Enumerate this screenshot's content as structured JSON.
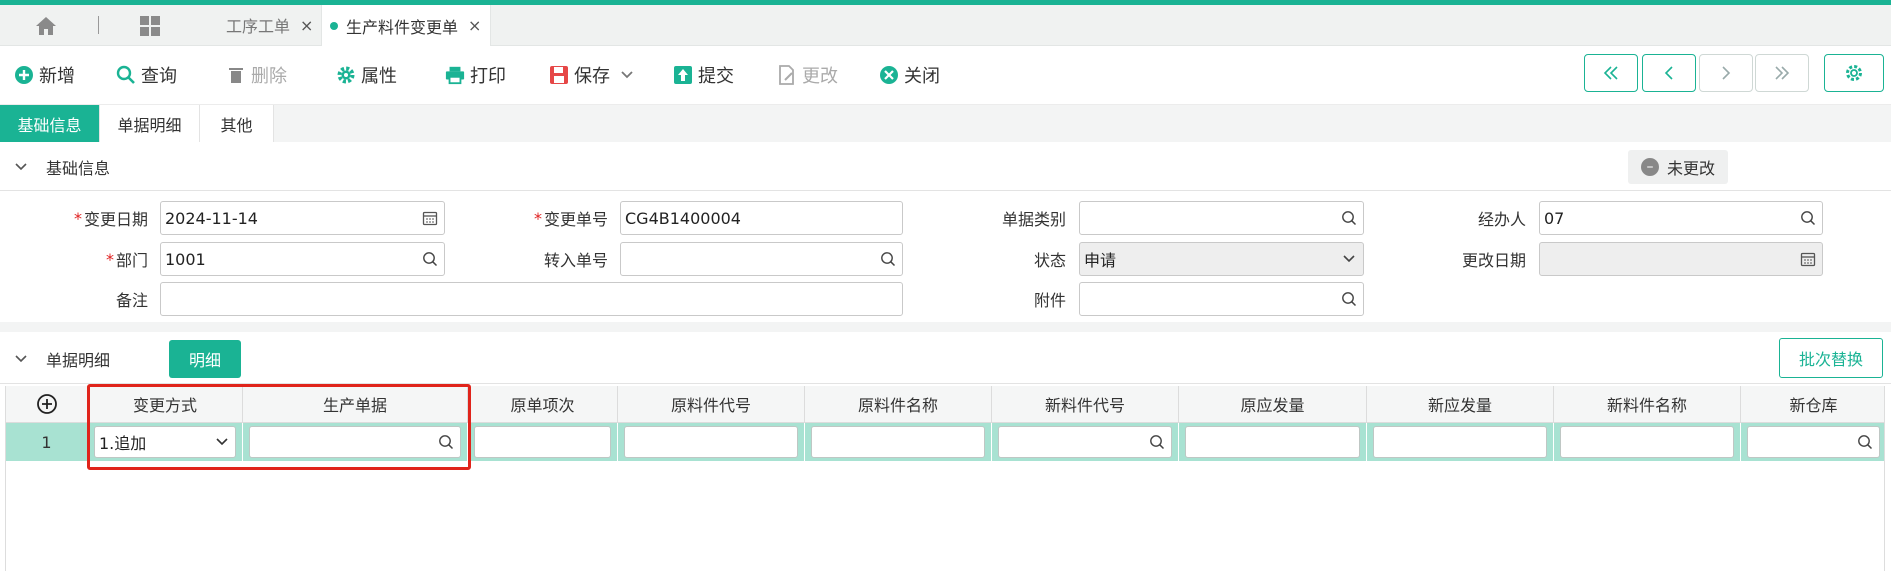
{
  "tabs": [
    {
      "label": "工序工单",
      "close": "×"
    },
    {
      "label": "生产料件变更单",
      "close": "×"
    }
  ],
  "toolbar": {
    "add": "新增",
    "query": "查询",
    "delete": "删除",
    "props": "属性",
    "print": "打印",
    "save": "保存",
    "submit": "提交",
    "change": "更改",
    "close": "关闭"
  },
  "section_tabs": [
    "基础信息",
    "单据明细",
    "其他"
  ],
  "basic": {
    "title": "基础信息",
    "status_badge": "未更改",
    "fields": {
      "change_date": {
        "label": "变更日期",
        "value": "2024-11-14"
      },
      "change_no": {
        "label": "变更单号",
        "value": "CG4B1400004"
      },
      "doc_type": {
        "label": "单据类别",
        "value": ""
      },
      "handler": {
        "label": "经办人",
        "value": "07"
      },
      "dept": {
        "label": "部门",
        "value": "1001"
      },
      "transfer_no": {
        "label": "转入单号",
        "value": ""
      },
      "state": {
        "label": "状态",
        "value": "申请"
      },
      "modify_date": {
        "label": "更改日期",
        "value": ""
      },
      "remark": {
        "label": "备注",
        "value": ""
      },
      "attach": {
        "label": "附件",
        "value": ""
      }
    },
    "required_mark": "*"
  },
  "detail": {
    "title": "单据明细",
    "btn_detail": "明细",
    "btn_batch": "批次替换",
    "columns": [
      "变更方式",
      "生产单据",
      "原单项次",
      "原料件代号",
      "原料件名称",
      "新料件代号",
      "原应发量",
      "新应发量",
      "新料件名称",
      "新仓库"
    ],
    "rows": [
      {
        "no": "1",
        "change_mode": "1.追加",
        "prod_doc": ""
      }
    ]
  },
  "colors": {
    "accent": "#1ab394",
    "highlight": "#e0241b",
    "row": "#a8e2d2"
  }
}
